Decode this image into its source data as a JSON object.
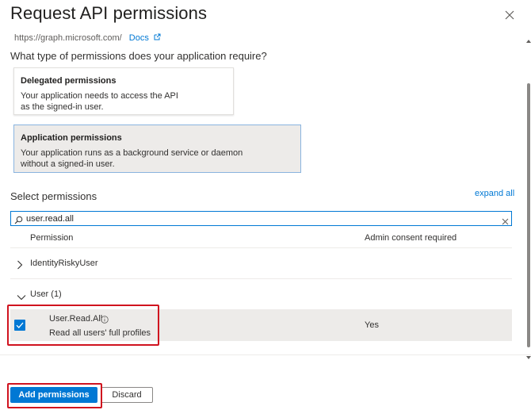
{
  "panel": {
    "title": "Request API permissions"
  },
  "api": {
    "url_clipped": "https://graph.microsoft.com/",
    "docs_label": "Docs"
  },
  "permission_type": {
    "question": "What type of permissions does your application require?",
    "options": [
      {
        "title": "Delegated permissions",
        "description": "Your application needs to access the API as the signed-in user.",
        "selected": false
      },
      {
        "title": "Application permissions",
        "description": "Your application runs as a background service or daemon without a signed-in user.",
        "selected": true
      }
    ]
  },
  "select_permissions": {
    "label": "Select permissions",
    "expand_all": "expand all",
    "search_value": "user.read.all",
    "columns": {
      "permission": "Permission",
      "admin_consent": "Admin consent required"
    },
    "groups": [
      {
        "name": "IdentityRiskyUser",
        "expanded": false
      },
      {
        "name": "User (1)",
        "expanded": true
      }
    ],
    "permissions": [
      {
        "name": "User.Read.All",
        "description": "Read all users' full profiles",
        "admin_consent": "Yes",
        "checked": true
      }
    ]
  },
  "footer": {
    "add_label": "Add permissions",
    "discard_label": "Discard"
  },
  "colors": {
    "accent": "#0078d4",
    "annotation_red": "#d0131f",
    "selected_bg": "#edebe9"
  }
}
